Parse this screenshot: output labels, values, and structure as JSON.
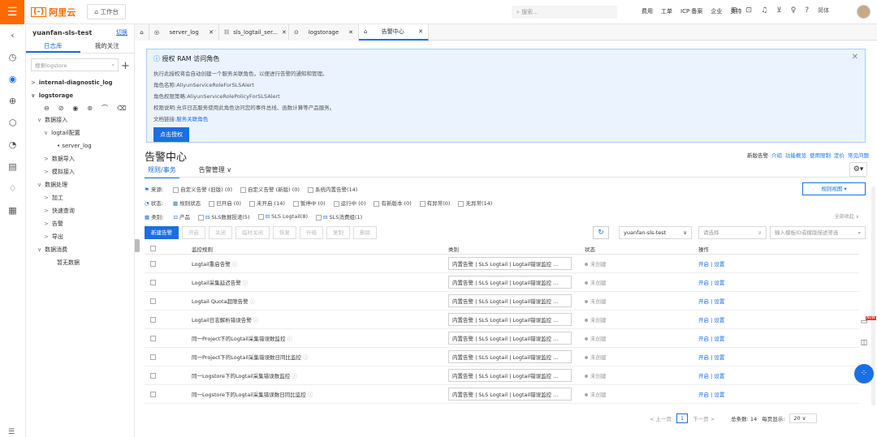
{
  "topbar": {
    "brand": "阿里云",
    "workbench": "工作台",
    "search_placeholder": "搜索...",
    "links": [
      "费用",
      "工单",
      "ICP 备案",
      "企业",
      "支持"
    ],
    "lang": "简体"
  },
  "sidebar": {
    "project": "yuanfan-sls-test",
    "switch": "切换",
    "tabs": [
      "日志库",
      "我的关注"
    ],
    "search_placeholder": "搜索logstore",
    "tree": [
      {
        "label": "internal-diagnostic_log",
        "level": 0,
        "bold": true,
        "arrow": ">"
      },
      {
        "label": "logstorage",
        "level": 0,
        "bold": true,
        "arrow": "∨"
      },
      {
        "label": "数据接入",
        "level": 1,
        "arrow": "∨"
      },
      {
        "label": "logtail配置",
        "level": 2,
        "arrow": "∨"
      },
      {
        "label": "• server_log",
        "level": 3,
        "arrow": ""
      },
      {
        "label": "数据导入",
        "level": 2,
        "arrow": ">"
      },
      {
        "label": "模拟接入",
        "level": 2,
        "arrow": ">"
      },
      {
        "label": "数据处理",
        "level": 1,
        "arrow": "∨"
      },
      {
        "label": "加工",
        "level": 2,
        "arrow": ">"
      },
      {
        "label": "快速查询",
        "level": 2,
        "arrow": ">"
      },
      {
        "label": "告警",
        "level": 2,
        "arrow": ">"
      },
      {
        "label": "导出",
        "level": 2,
        "arrow": ">"
      },
      {
        "label": "数据消费",
        "level": 1,
        "arrow": "∨"
      },
      {
        "label": "暂无数据",
        "level": 3,
        "arrow": ""
      }
    ]
  },
  "tabs": [
    {
      "label": "server_log"
    },
    {
      "label": "sls_logtail_ser..."
    },
    {
      "label": "logstorage"
    },
    {
      "label": "告警中心"
    }
  ],
  "notice": {
    "title": "授权 RAM 访问角色",
    "lines": [
      "执行此授权将会自动创建一个服务关联角色，以便进行告警的通知和管理。",
      "角色名称:AliyunServiceRoleForSLSAlert",
      "角色权限策略:AliyunServiceRolePolicyForSLSAlert",
      "权限说明:允许日志服务使用此角色访问您的事件总线、函数计算等产品服务。"
    ],
    "doc_prefix": "文档链接:",
    "doc_link": "服务关联角色",
    "button": "点击授权"
  },
  "page": {
    "title": "告警中心",
    "tabs": [
      "规则/事务",
      "告警管理 ∨"
    ],
    "help_links": [
      "新版告警",
      "介绍",
      "功能概览",
      "使用限制",
      "定价",
      "常见问题"
    ],
    "view_button": "规则视图 ▾",
    "fold_all": "全部收起 ∨"
  },
  "filters": {
    "source": {
      "label": "来源:",
      "options": [
        "自定义告警 (旧版) (0)",
        "自定义告警 (新版) (0)",
        "系统内置告警(14)"
      ]
    },
    "status": {
      "label": "状态:",
      "sub": "规则状态",
      "options": [
        "已开启 (0)",
        "未开启 (14)",
        "暂停中 (0)",
        "运行中 (0)",
        "有新版本 (0)",
        "有异常(0)",
        "无异常(14)"
      ]
    },
    "category": {
      "label": "类别:",
      "sub": "产品",
      "options": [
        "SLS数据投递(5)",
        "SLS Logtail(8)",
        "SLS消费组(1)"
      ]
    }
  },
  "actions": [
    "新建告警",
    "开启",
    "关闭",
    "临时关闭",
    "恢复",
    "升级",
    "复制",
    "删除"
  ],
  "toolbar": {
    "project_select": "yuanfan-sls-test",
    "select_placeholder": "请选择",
    "search_placeholder": "输入模板ID或模版描述筛选"
  },
  "table": {
    "headers": [
      "监控规则",
      "类别",
      "状态",
      "操作"
    ],
    "rows": [
      {
        "rule": "Logtail重启告警",
        "tags": "内置告警 | SLS Logtail | Logtail错误监控 ...",
        "status": "未创建",
        "ops": "开启 | 设置"
      },
      {
        "rule": "Logtail采集延迟告警",
        "tags": "内置告警 | SLS Logtail | Logtail错误监控 ...",
        "status": "未创建",
        "ops": "开启 | 设置"
      },
      {
        "rule": "Logtail Quota超限告警",
        "tags": "内置告警 | SLS Logtail | Logtail错误监控 ...",
        "status": "未创建",
        "ops": "开启 | 设置"
      },
      {
        "rule": "Logtail日志解析错误告警",
        "tags": "内置告警 | SLS Logtail | Logtail错误监控 ...",
        "status": "未创建",
        "ops": "开启 | 设置"
      },
      {
        "rule": "同一Project下的Logtail采集错误数监控",
        "tags": "内置告警 | SLS Logtail | Logtail错误监控 ...",
        "status": "未创建",
        "ops": "开启 | 设置"
      },
      {
        "rule": "同一Project下的Logtail采集错误数日同比监控",
        "tags": "内置告警 | SLS Logtail | Logtail错误监控 ...",
        "status": "未创建",
        "ops": "开启 | 设置"
      },
      {
        "rule": "同一Logstore下的Logtail采集错误数监控",
        "tags": "内置告警 | SLS Logtail | Logtail错误监控 ...",
        "status": "未创建",
        "ops": "开启 | 设置"
      },
      {
        "rule": "同一Logstore下的Logtail采集错误数日同比监控",
        "tags": "内置告警 | SLS Logtail | Logtail错误监控 ...",
        "status": "未创建",
        "ops": "开启 | 设置"
      }
    ]
  },
  "pager": {
    "prev": "< 上一页",
    "page": "1",
    "next": "下一页 >",
    "total": "总条数: 14",
    "per_page_label": "每页显示:",
    "per_page": "20"
  }
}
